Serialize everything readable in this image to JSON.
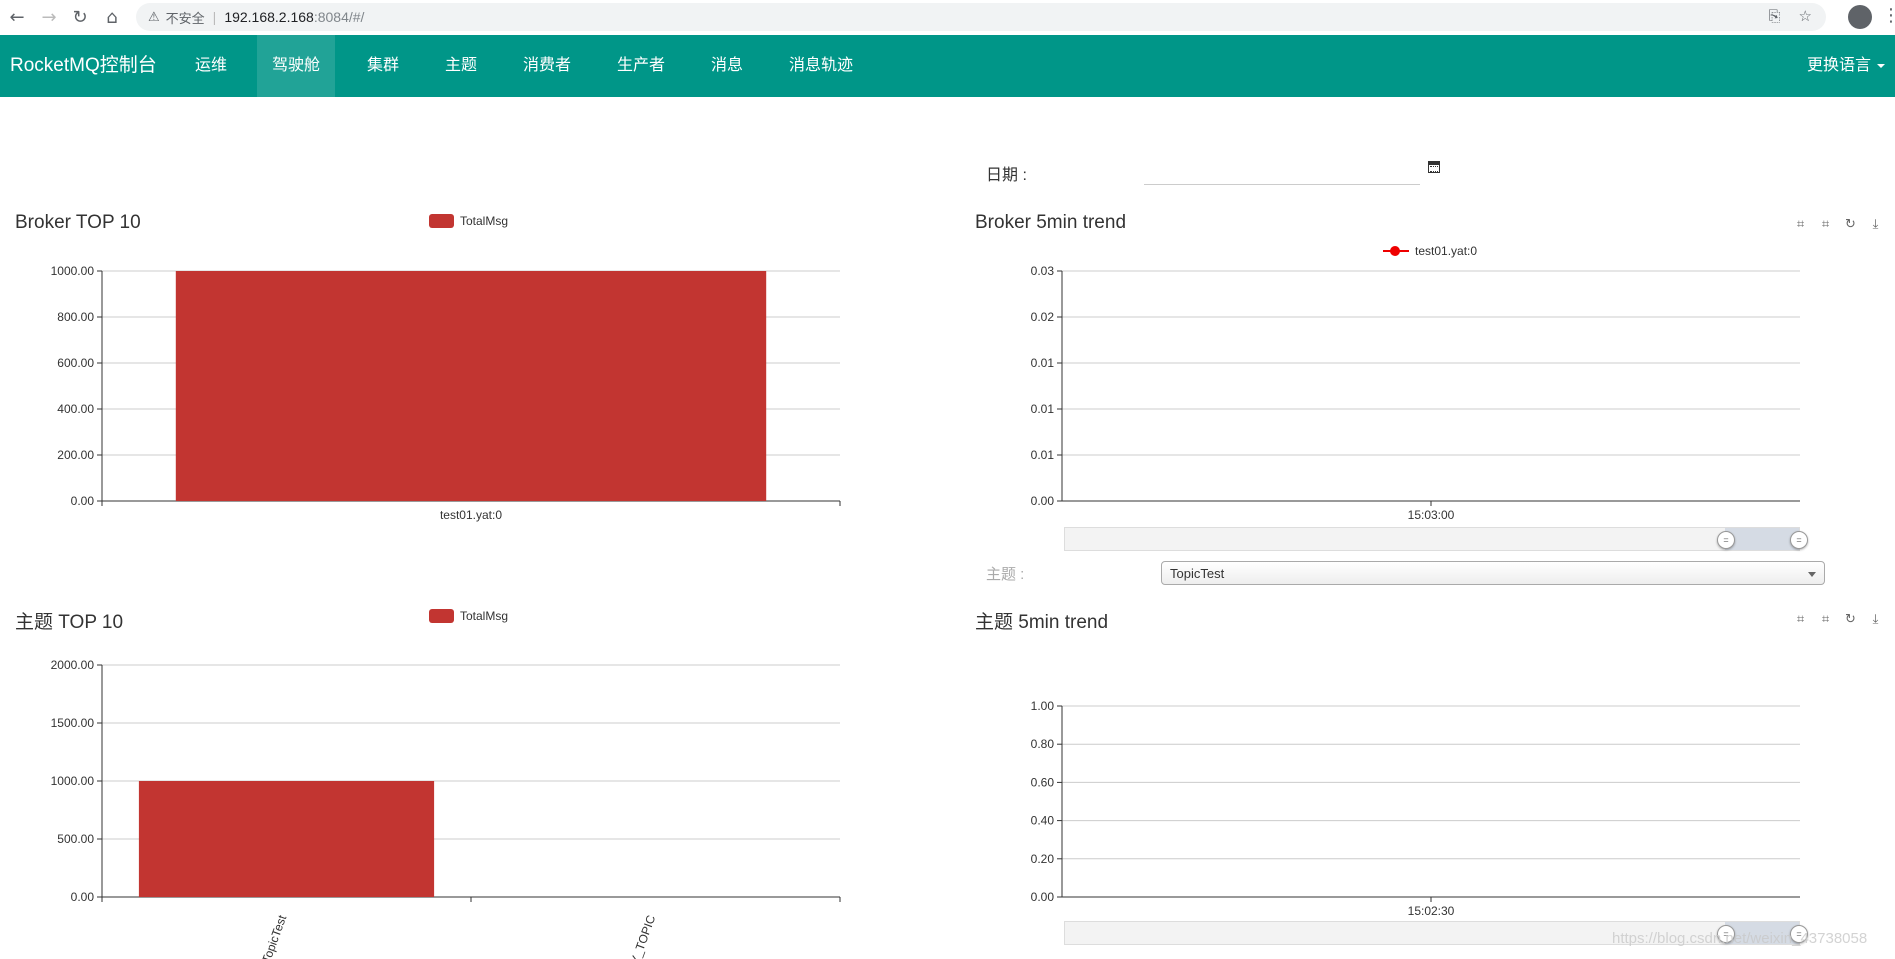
{
  "browser": {
    "insecure_label": "不安全",
    "url_host": "192.168.2.168",
    "url_path": ":8084/#/"
  },
  "navbar": {
    "brand": "RocketMQ控制台",
    "items": [
      {
        "label": "运维"
      },
      {
        "label": "驾驶舱",
        "active": true
      },
      {
        "label": "集群"
      },
      {
        "label": "主题"
      },
      {
        "label": "消费者"
      },
      {
        "label": "生产者"
      },
      {
        "label": "消息"
      },
      {
        "label": "消息轨迹"
      }
    ],
    "language": "更换语言",
    "bg_color": "#009688"
  },
  "date": {
    "label": "日期 :",
    "value": ""
  },
  "topic_select": {
    "label": "主题 :",
    "selected": "TopicTest"
  },
  "watermark": "https://blog.csdn.net/weixin_43738058",
  "chart_data": [
    {
      "type": "bar",
      "title": "Broker TOP 10",
      "legend": [
        "TotalMsg"
      ],
      "categories": [
        "test01.yat:0"
      ],
      "series": [
        {
          "name": "TotalMsg",
          "values": [
            1000
          ]
        }
      ],
      "ylim": [
        0,
        1000
      ],
      "yticks": [
        "0.00",
        "200.00",
        "400.00",
        "600.00",
        "800.00",
        "1000.00"
      ],
      "color": "#c23531",
      "grid": true,
      "legend_position": "top-center"
    },
    {
      "type": "line",
      "title": "Broker 5min trend",
      "legend": [
        "test01.yat:0"
      ],
      "x": [
        "15:03:00"
      ],
      "series": [
        {
          "name": "test01.yat:0",
          "values": []
        }
      ],
      "yticks": [
        "0.00",
        "0.01",
        "0.01",
        "0.01",
        "0.02",
        "0.03"
      ],
      "color": "#ff0000",
      "grid": true,
      "legend_position": "top-center",
      "datazoom_range": [
        0.9,
        1.0
      ]
    },
    {
      "type": "bar",
      "title": "主题 TOP 10",
      "legend": [
        "TotalMsg"
      ],
      "categories": [
        "TopicTest",
        "PLY_TOPIC"
      ],
      "series": [
        {
          "name": "TotalMsg",
          "values": [
            1000,
            0
          ]
        }
      ],
      "ylim": [
        0,
        2000
      ],
      "yticks": [
        "0.00",
        "500.00",
        "1000.00",
        "1500.00",
        "2000.00"
      ],
      "color": "#c23531",
      "grid": true,
      "legend_position": "top-center"
    },
    {
      "type": "line",
      "title": "主题 5min trend",
      "x": [
        "15:02:30"
      ],
      "series": [],
      "yticks": [
        "0.00",
        "0.20",
        "0.40",
        "0.60",
        "0.80",
        "1.00"
      ],
      "grid": true,
      "datazoom_range": [
        0.9,
        1.0
      ]
    }
  ]
}
